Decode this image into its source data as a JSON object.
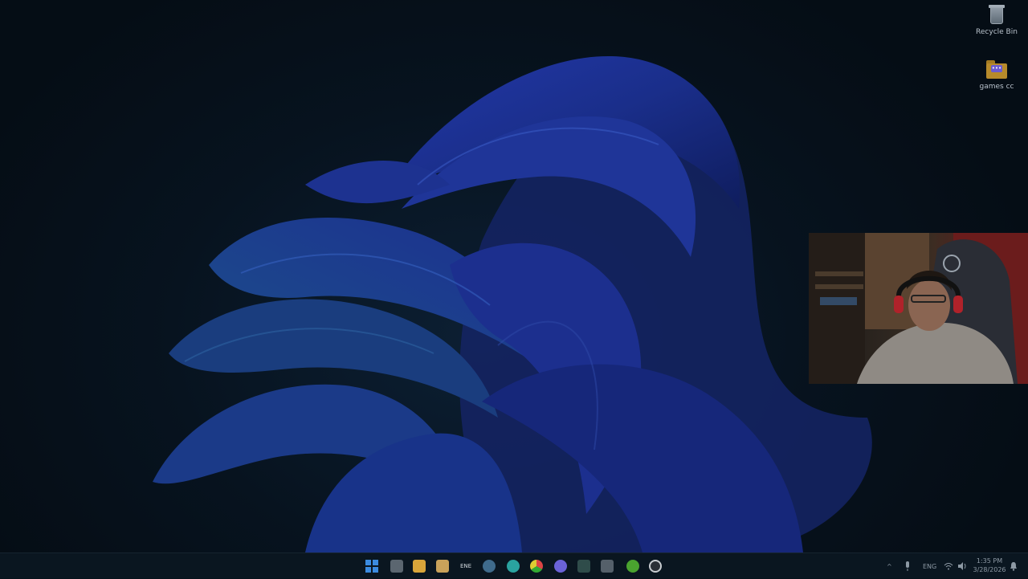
{
  "desktop": {
    "icons": [
      {
        "label": "Recycle Bin",
        "icon": "recycle-bin-icon"
      },
      {
        "label": "games cc",
        "icon": "folder-icon"
      }
    ]
  },
  "taskbar": {
    "apps": [
      {
        "name": "start",
        "icon": "windows-start-icon",
        "color": "#2b7fd4"
      },
      {
        "name": "file-explorer-dark",
        "icon": "window-icon",
        "color": "#5b6670"
      },
      {
        "name": "file-explorer",
        "icon": "folder-icon",
        "color": "#d9a53a"
      },
      {
        "name": "store",
        "icon": "store-icon",
        "color": "#c9a25a"
      },
      {
        "name": "ene",
        "icon": "ene-icon",
        "label": "ENE",
        "color": "#39424b"
      },
      {
        "name": "steam",
        "icon": "steam-icon",
        "color": "#3f6b8c"
      },
      {
        "name": "edge",
        "icon": "edge-icon",
        "color": "#2aa3a0"
      },
      {
        "name": "chrome",
        "icon": "chrome-icon",
        "color": "#d8a42a"
      },
      {
        "name": "discord",
        "icon": "discord-icon",
        "color": "#6b63d8"
      },
      {
        "name": "terminal",
        "icon": "terminal-icon",
        "color": "#2f4c4a"
      },
      {
        "name": "app-grid",
        "icon": "grid-app-icon",
        "color": "#55606a"
      },
      {
        "name": "xbox",
        "icon": "xbox-icon",
        "color": "#4aa32f"
      },
      {
        "name": "obs",
        "icon": "record-icon",
        "color": "#2a2f36"
      }
    ],
    "tray": {
      "chevron": "^",
      "language": "ENG",
      "time": "1:35 PM",
      "date": "3/28/2026"
    }
  }
}
